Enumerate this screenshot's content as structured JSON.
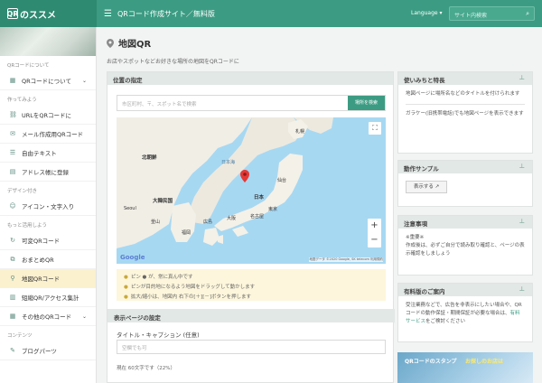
{
  "header": {
    "logo_mark": "QR",
    "logo_text": "のススメ",
    "menu_icon": "hamburger-icon",
    "site_title": "QRコード作成サイト／無料版",
    "language": "Language ▾",
    "search_placeholder": "サイト内検索"
  },
  "sidebar": {
    "groups": [
      {
        "heading": "QRコードについて",
        "items": [
          {
            "label": "QRコードについて",
            "icon": "qr-icon",
            "has_chevron": true
          }
        ]
      },
      {
        "heading": "作ってみよう",
        "items": [
          {
            "label": "URLをQRコードに",
            "icon": "link-icon"
          },
          {
            "label": "メール作成用QRコード",
            "icon": "mail-icon"
          },
          {
            "label": "自由テキスト",
            "icon": "text-icon"
          },
          {
            "label": "アドレス帳に登録",
            "icon": "contact-icon"
          }
        ]
      },
      {
        "heading": "デザイン付き",
        "items": [
          {
            "label": "アイコン・文字入り",
            "icon": "smile-icon"
          }
        ]
      },
      {
        "heading": "もっと活用しよう",
        "items": [
          {
            "label": "可変QRコード",
            "icon": "refresh-icon"
          },
          {
            "label": "おまとめQR",
            "icon": "stack-icon"
          },
          {
            "label": "地図QRコード",
            "icon": "map-pin-icon",
            "active": true
          },
          {
            "label": "短縮QR/アクセス集計",
            "icon": "chart-icon"
          },
          {
            "label": "その他のQRコード",
            "icon": "grid-icon",
            "has_chevron": true
          }
        ]
      },
      {
        "heading": "コンテンツ",
        "items": [
          {
            "label": "ブログパーツ",
            "icon": "blog-icon"
          }
        ]
      }
    ]
  },
  "page": {
    "title": "地図QR",
    "subtitle": "お店やスポットなどお好きな場所の地図をQRコードに"
  },
  "location_card": {
    "heading": "位置の指定",
    "address_placeholder": "市区町村、〒、スポット名で検索",
    "search_button": "場所を検索",
    "map_labels": {
      "north_korea": "北朝鮮",
      "south_korea": "大韓民国",
      "japan": "日本",
      "sea_of_japan": "日本海",
      "sapporo": "札幌",
      "sendai": "仙台",
      "tokyo": "東京",
      "nagoya": "名古屋",
      "osaka": "大阪",
      "hiroshima": "広島",
      "fukuoka": "福岡",
      "seoul": "Seoul",
      "busan": "釜山"
    },
    "google_logo": "Google",
    "attribution": "地図データ ©2020 Google, SK telecom   利用規約",
    "hints": [
      "ピン ● が、常に真ん中です",
      "ピンが目的地になるよう地図をドラッグして動かします",
      "拡大/縮小は、地図内 右下の[＋][－]ボタンを押します"
    ]
  },
  "display_settings": {
    "heading": "表示ページの設定",
    "caption_label": "タイトル・キャプション (任意)",
    "caption_placeholder": "空欄でも可",
    "char_count": "現在 60文字です（22%）"
  },
  "right_cards": {
    "usage": {
      "heading": "使いみちと特長",
      "text1": "地図ページに場所名などのタイトルを付けられます",
      "text2": "ガラケー(旧携帯電話)でも地図ページを表示できます"
    },
    "sample": {
      "heading": "動作サンプル",
      "button": "表示する ↗"
    },
    "notes": {
      "heading": "注意事項",
      "text": "※重要※\n作成後は、必ずご自分で読み取り確認と、ページの表示確認をしましょう"
    },
    "paid": {
      "heading": "有料版のご案内",
      "text": "受注業務などで、広告を非表示にしたい場合や、QRコードの動作保証・期間保証が必要な場合は、",
      "link": "有料サービス",
      "text_after": "をご検討ください"
    },
    "ad": {
      "text": "QRコードのスタンプ",
      "highlight": "お探しのお店は"
    }
  }
}
